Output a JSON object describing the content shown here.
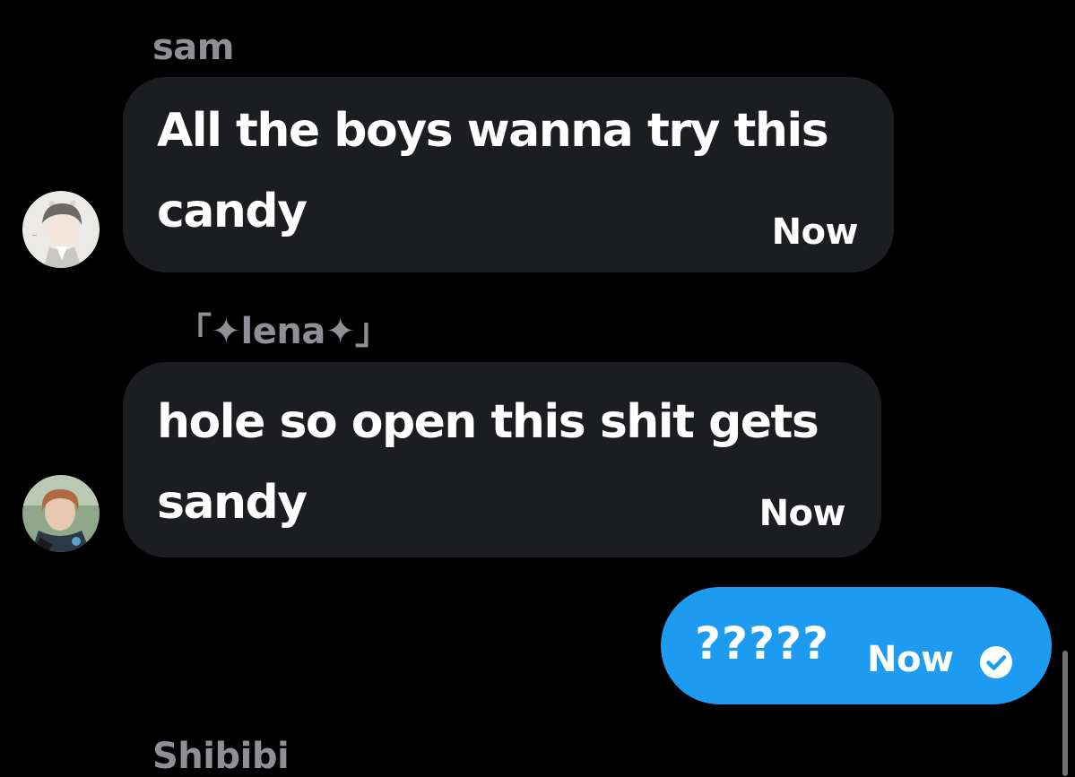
{
  "colors": {
    "background": "#000000",
    "incoming_bubble": "#1c1d20",
    "outgoing_bubble": "#1d9bf0",
    "sender_name": "#8e9095",
    "text": "#ffffff"
  },
  "messages": [
    {
      "sender": "sam",
      "text": "All the boys wanna try this\ncandy",
      "time": "Now",
      "avatar_icon": "user-avatar-icon"
    },
    {
      "sender": "「✦lena✦」",
      "text": "hole so open this shit gets\nsandy",
      "time": "Now",
      "avatar_icon": "user-avatar-icon"
    }
  ],
  "own_message": {
    "text": "?????",
    "time": "Now",
    "status_icon": "check-circle-icon"
  },
  "next_sender": "Shibibi"
}
